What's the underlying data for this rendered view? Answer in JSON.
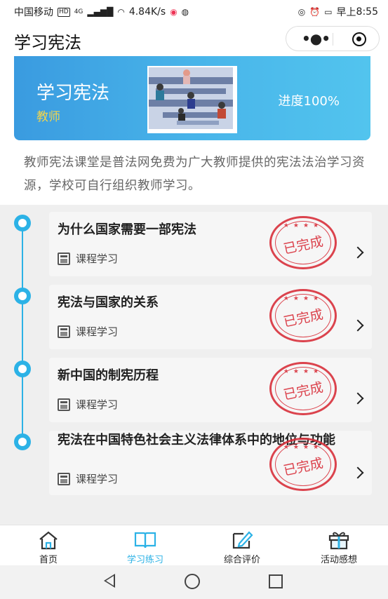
{
  "status_bar": {
    "carrier": "中国移动",
    "network_badge": "HD",
    "network_type": "4G",
    "speed": "4.84K/s",
    "time_prefix": "早上",
    "time": "8:55",
    "icons": [
      "signal-icon",
      "wifi-icon",
      "app-icon",
      "wechat-icon",
      "eye-icon",
      "alarm-icon",
      "battery-icon"
    ]
  },
  "title_bar": {
    "title": "学习宪法",
    "more_icon": "more-dots-icon",
    "close_icon": "target-icon"
  },
  "banner": {
    "title": "学习宪法",
    "subtitle": "教师",
    "progress": "进度100%",
    "accent_color": "#3a9be0",
    "subtitle_color": "#f5d54a"
  },
  "intro": {
    "text": "教师宪法课堂是普法网免费为广大教师提供的宪法法治学习资源，学校可自行组织教师学习。"
  },
  "lessons": [
    {
      "title": "为什么国家需要一部宪法",
      "meta": "课程学习",
      "stamp": "已完成"
    },
    {
      "title": "宪法与国家的关系",
      "meta": "课程学习",
      "stamp": "已完成"
    },
    {
      "title": "新中国的制宪历程",
      "meta": "课程学习",
      "stamp": "已完成"
    },
    {
      "title": "宪法在中国特色社会主义法律体系中的地位与功能",
      "meta": "课程学习",
      "stamp": "已完成"
    }
  ],
  "tabs": [
    {
      "label": "首页",
      "icon": "home-icon",
      "active": false
    },
    {
      "label": "学习练习",
      "icon": "book-icon",
      "active": true
    },
    {
      "label": "综合评价",
      "icon": "edit-icon",
      "active": false
    },
    {
      "label": "活动感想",
      "icon": "gift-icon",
      "active": false
    }
  ],
  "colors": {
    "accent": "#2cb2e6",
    "stamp": "#d9303b"
  }
}
